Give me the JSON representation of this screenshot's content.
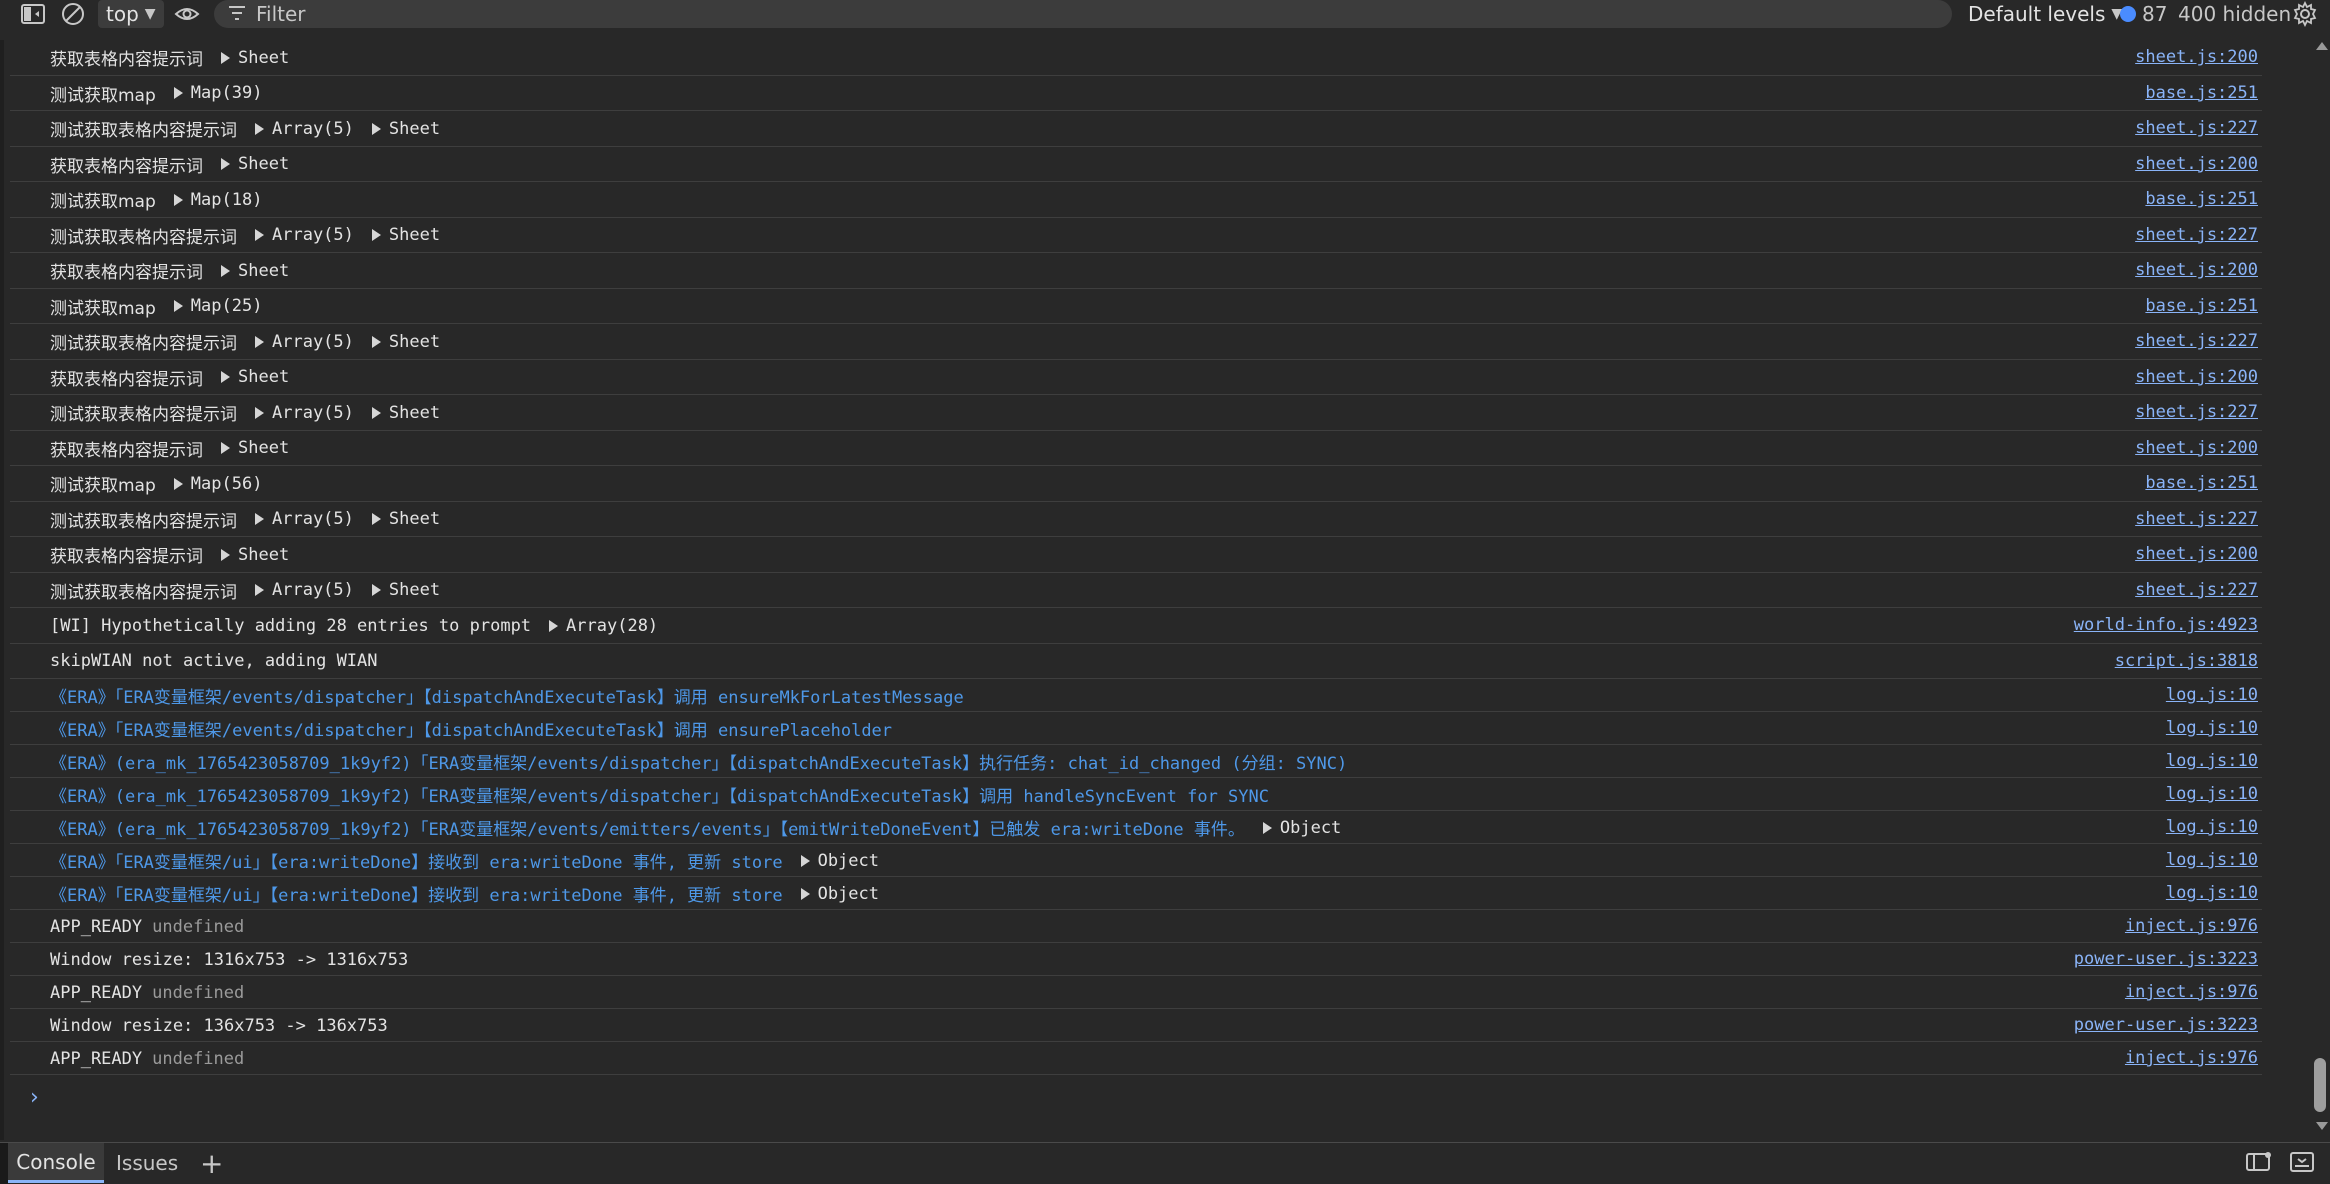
{
  "toolbar": {
    "context": "top",
    "filter_placeholder": "Filter",
    "levels": "Default levels",
    "issues_count": "87",
    "hidden_count": "400 hidden"
  },
  "rows": [
    {
      "msg": "获取表格内容提示词",
      "chips": [
        "Sheet"
      ],
      "src": "sheet.js:200"
    },
    {
      "msg": "测试获取map",
      "chips": [
        "Map(39)"
      ],
      "src": "base.js:251"
    },
    {
      "msg": "测试获取表格内容提示词",
      "chips": [
        "Array(5)",
        "Sheet"
      ],
      "src": "sheet.js:227"
    },
    {
      "msg": "获取表格内容提示词",
      "chips": [
        "Sheet"
      ],
      "src": "sheet.js:200"
    },
    {
      "msg": "测试获取map",
      "chips": [
        "Map(18)"
      ],
      "src": "base.js:251"
    },
    {
      "msg": "测试获取表格内容提示词",
      "chips": [
        "Array(5)",
        "Sheet"
      ],
      "src": "sheet.js:227"
    },
    {
      "msg": "获取表格内容提示词",
      "chips": [
        "Sheet"
      ],
      "src": "sheet.js:200"
    },
    {
      "msg": "测试获取map",
      "chips": [
        "Map(25)"
      ],
      "src": "base.js:251"
    },
    {
      "msg": "测试获取表格内容提示词",
      "chips": [
        "Array(5)",
        "Sheet"
      ],
      "src": "sheet.js:227"
    },
    {
      "msg": "获取表格内容提示词",
      "chips": [
        "Sheet"
      ],
      "src": "sheet.js:200"
    },
    {
      "msg": "测试获取表格内容提示词",
      "chips": [
        "Array(5)",
        "Sheet"
      ],
      "src": "sheet.js:227"
    },
    {
      "msg": "获取表格内容提示词",
      "chips": [
        "Sheet"
      ],
      "src": "sheet.js:200"
    },
    {
      "msg": "测试获取map",
      "chips": [
        "Map(56)"
      ],
      "src": "base.js:251"
    },
    {
      "msg": "测试获取表格内容提示词",
      "chips": [
        "Array(5)",
        "Sheet"
      ],
      "src": "sheet.js:227"
    },
    {
      "msg": "获取表格内容提示词",
      "chips": [
        "Sheet"
      ],
      "src": "sheet.js:200"
    },
    {
      "msg": "测试获取表格内容提示词",
      "chips": [
        "Array(5)",
        "Sheet"
      ],
      "src": "sheet.js:227"
    },
    {
      "msg": "[WI] Hypothetically adding 28 entries to prompt",
      "chips": [
        "Array(28)"
      ],
      "src": "world-info.js:4923"
    },
    {
      "msg": "skipWIAN not active, adding WIAN",
      "chips": [],
      "src": "script.js:3818"
    },
    {
      "msg": "《ERA》「ERA变量框架/events/dispatcher」【dispatchAndExecuteTask】调用 ensureMkForLatestMessage",
      "chips": [],
      "src": "log.js:10",
      "era": true
    },
    {
      "msg": "《ERA》「ERA变量框架/events/dispatcher」【dispatchAndExecuteTask】调用 ensurePlaceholder",
      "chips": [],
      "src": "log.js:10",
      "era": true
    },
    {
      "msg": "《ERA》(era_mk_1765423058709_1k9yf2)「ERA变量框架/events/dispatcher」【dispatchAndExecuteTask】执行任务: chat_id_changed (分组: SYNC)",
      "chips": [],
      "src": "log.js:10",
      "era": true
    },
    {
      "msg": "《ERA》(era_mk_1765423058709_1k9yf2)「ERA变量框架/events/dispatcher」【dispatchAndExecuteTask】调用 handleSyncEvent for SYNC",
      "chips": [],
      "src": "log.js:10",
      "era": true
    },
    {
      "msg": "《ERA》(era_mk_1765423058709_1k9yf2)「ERA变量框架/events/emitters/events」【emitWriteDoneEvent】已触发 era:writeDone 事件。",
      "chips": [
        "Object"
      ],
      "src": "log.js:10",
      "era": true
    },
    {
      "msg": "《ERA》「ERA变量框架/ui」【era:writeDone】接收到 era:writeDone 事件, 更新 store",
      "chips": [
        "Object"
      ],
      "src": "log.js:10",
      "era": true
    },
    {
      "msg": "《ERA》「ERA变量框架/ui」【era:writeDone】接收到 era:writeDone 事件, 更新 store",
      "chips": [
        "Object"
      ],
      "src": "log.js:10",
      "era": true
    },
    {
      "msg": "APP_READY",
      "undef": "undefined",
      "chips": [],
      "src": "inject.js:976"
    },
    {
      "msg": "Window resize: 1316x753 -> 1316x753",
      "chips": [],
      "src": "power-user.js:3223"
    },
    {
      "msg": "APP_READY",
      "undef": "undefined",
      "chips": [],
      "src": "inject.js:976"
    },
    {
      "msg": "Window resize: 136x753 -> 136x753",
      "chips": [],
      "src": "power-user.js:3223"
    },
    {
      "msg": "APP_READY",
      "undef": "undefined",
      "chips": [],
      "src": "inject.js:976"
    }
  ],
  "prompt": "›",
  "drawer": {
    "tab_console": "Console",
    "tab_issues": "Issues",
    "add": "+"
  }
}
